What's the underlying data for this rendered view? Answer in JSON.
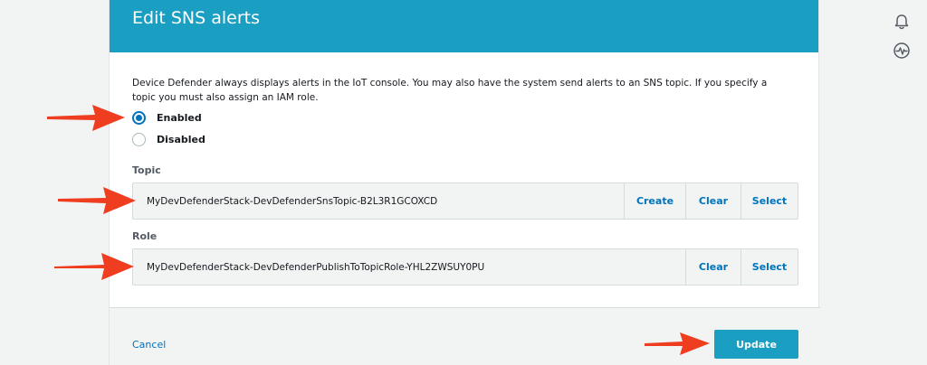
{
  "modal": {
    "title": "Edit SNS alerts",
    "description": "Device Defender always displays alerts in the IoT console. You may also have the system send alerts to an SNS topic. If you specify a topic you must also assign an IAM role."
  },
  "alerts": {
    "options": [
      {
        "label": "Enabled",
        "checked": true
      },
      {
        "label": "Disabled",
        "checked": false
      }
    ]
  },
  "topic": {
    "label": "Topic",
    "value": "MyDevDefenderStack-DevDefenderSnsTopic-B2L3R1GCOXCD",
    "create_label": "Create",
    "clear_label": "Clear",
    "select_label": "Select"
  },
  "role": {
    "label": "Role",
    "value": "MyDevDefenderStack-DevDefenderPublishToTopicRole-YHL2ZWSUY0PU",
    "clear_label": "Clear",
    "select_label": "Select"
  },
  "footer": {
    "cancel_label": "Cancel",
    "update_label": "Update"
  },
  "sidebar_icons": [
    "bell-icon",
    "activity-icon"
  ],
  "colors": {
    "header": "#1a9ec2",
    "link": "#0073bb",
    "annotation_arrow": "#ee3d1f"
  }
}
